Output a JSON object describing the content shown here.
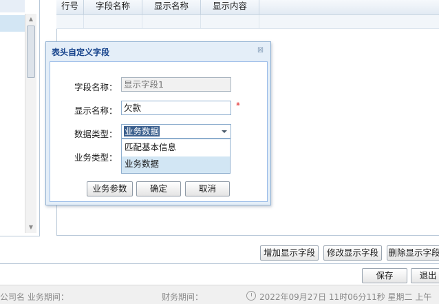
{
  "grid": {
    "columns": [
      "行号",
      "字段名称",
      "显示名称",
      "显示内容"
    ]
  },
  "buttons": {
    "add": "增加显示字段",
    "edit": "修改显示字段",
    "delete": "删除显示字段",
    "save": "保存",
    "back": "退出"
  },
  "status": {
    "left": "公司名 业务期间：    ",
    "middle": "财务期间：    ",
    "datetime": "2022年09月27日 11时06分11秒 星期二 上午"
  },
  "dialog": {
    "title": "表头自定义字段",
    "close_icon": "close-icon",
    "fields": {
      "field_name_label": "字段名称：",
      "field_name_value": "显示字段1",
      "display_name_label": "显示名称：",
      "display_name_value": "欠款",
      "required_mark": "*",
      "data_type_label": "数据类型：",
      "data_type_value": "业务数据",
      "business_type_label": "业务类型："
    },
    "dropdown_options": [
      "匹配基本信息",
      "业务数据"
    ],
    "buttons": {
      "params": "业务参数",
      "ok": "确定",
      "cancel": "取消"
    }
  },
  "colors": {
    "title": "#15428b",
    "dialog_bg": "#e4eef8",
    "border": "#8fafcf",
    "required": "#e02020",
    "selected_option": "#d2e6f4"
  }
}
